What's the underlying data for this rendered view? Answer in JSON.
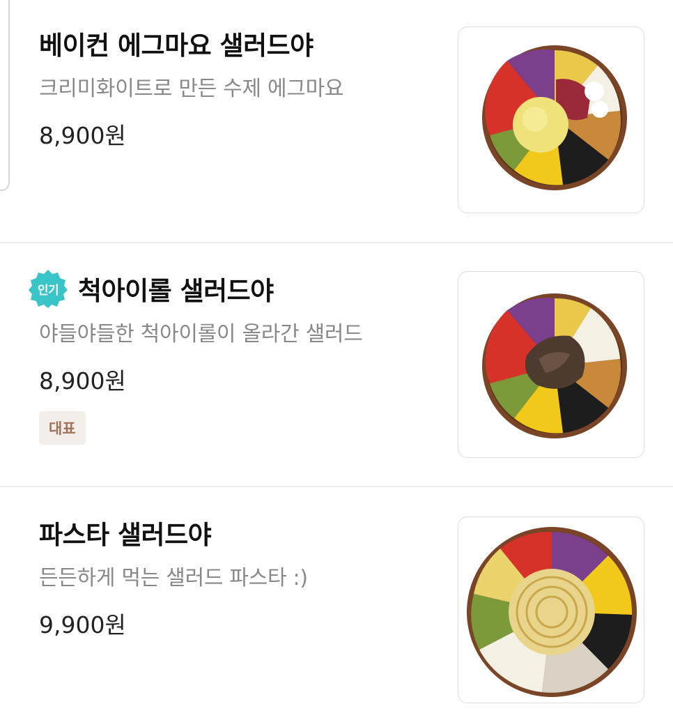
{
  "menu": {
    "items": [
      {
        "name": "베이컨 에그마요 샐러드야",
        "description": "크리미화이트로 만든 수제 에그마요",
        "price": "8,900원",
        "image_icon": "salad-bowl-egg-mayo"
      },
      {
        "badge": "인기",
        "name": "척아이롤 샐러드야",
        "description": "야들야들한 척아이롤이 올라간 샐러드",
        "price": "8,900원",
        "tag": "대표",
        "image_icon": "salad-bowl-chuck-eye-roll"
      },
      {
        "name": "파스타 샐러드야",
        "description": "든든하게 먹는 샐러드 파스타 :)",
        "price": "9,900원",
        "image_icon": "salad-bowl-pasta"
      }
    ]
  },
  "colors": {
    "badge_popular": "#39c5c8",
    "tag_bg": "#f3eeea",
    "tag_text": "#a0705a",
    "description": "#888888"
  }
}
